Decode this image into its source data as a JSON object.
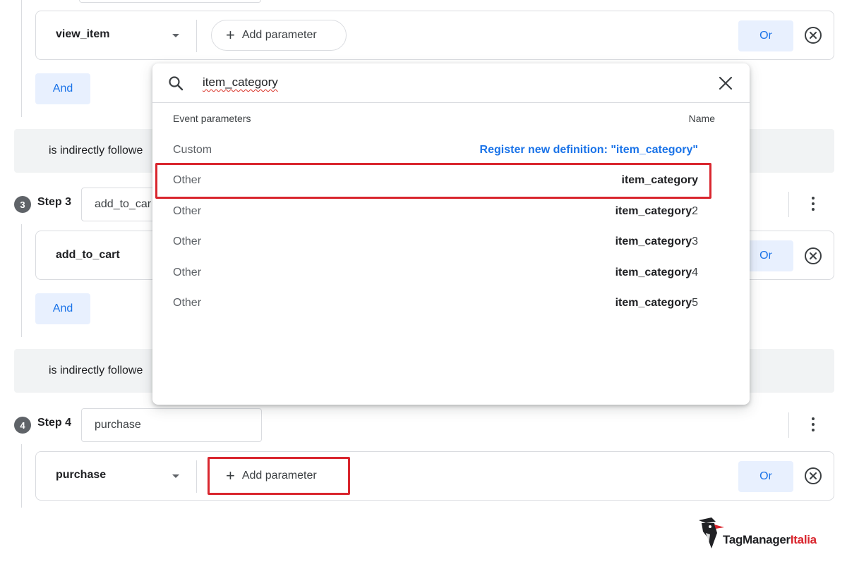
{
  "colors": {
    "accent": "#1a73e8",
    "highlight_red": "#d9262e",
    "chip_bg": "#e8f0fe",
    "bar_bg": "#f1f3f4"
  },
  "step2": {
    "event_name": "view_item",
    "add_parameter_label": "Add parameter",
    "or_label": "Or",
    "and_label": "And"
  },
  "followed_bar_1": {
    "text": "is indirectly followe"
  },
  "step3": {
    "number": "3",
    "label": "Step 3",
    "input_value": "add_to_car",
    "event_name": "add_to_cart",
    "or_label": "Or",
    "and_label": "And"
  },
  "followed_bar_2": {
    "text": "is indirectly followe"
  },
  "step4": {
    "number": "4",
    "label": "Step 4",
    "input_value": "purchase",
    "event_name": "purchase",
    "add_parameter_label": "Add parameter",
    "or_label": "Or"
  },
  "popup": {
    "search_value": "item_category",
    "header_left": "Event parameters",
    "header_right": "Name",
    "options": [
      {
        "category": "Custom",
        "name": "Register new definition: \"item_category\"",
        "name_bold": "",
        "name_suffix": ""
      },
      {
        "category": "Other",
        "name": "",
        "name_bold": "item_category",
        "name_suffix": ""
      },
      {
        "category": "Other",
        "name": "",
        "name_bold": "item_category",
        "name_suffix": "2"
      },
      {
        "category": "Other",
        "name": "",
        "name_bold": "item_category",
        "name_suffix": "3"
      },
      {
        "category": "Other",
        "name": "",
        "name_bold": "item_category",
        "name_suffix": "4"
      },
      {
        "category": "Other",
        "name": "",
        "name_bold": "item_category",
        "name_suffix": "5"
      }
    ]
  },
  "brand": {
    "part1": "TagManager",
    "part2": "Italia"
  }
}
